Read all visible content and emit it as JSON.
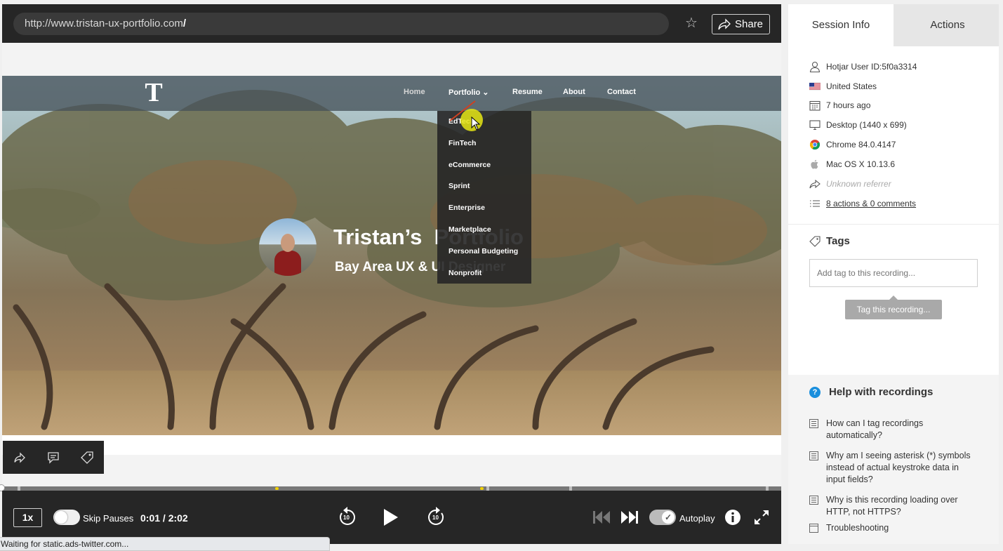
{
  "browser": {
    "url_base": "http://www.tristan-ux-portfolio.com",
    "url_suffix": "/",
    "share_label": "Share"
  },
  "site": {
    "logo": "T",
    "nav": [
      "Home",
      "Portfolio",
      "Resume",
      "About",
      "Contact"
    ],
    "dropdown": [
      "EdTech",
      "FinTech",
      "eCommerce",
      "Sprint",
      "Enterprise",
      "Marketplace",
      "Personal Budgeting",
      "Nonprofit"
    ],
    "hero_title": "Tristan’s  Portfolio",
    "hero_subtitle": "Bay Area UX & UI Designer"
  },
  "player": {
    "speed": "1x",
    "skip_pauses_label": "Skip Pauses",
    "time": "0:01 / 2:02",
    "rewind_label": "10",
    "forward_label": "10",
    "autoplay_label": "Autoplay",
    "skip_pauses_on": false,
    "autoplay_on": true
  },
  "status": "Waiting for static.ads-twitter.com...",
  "sidebar": {
    "tabs": [
      "Session Info",
      "Actions"
    ],
    "info": {
      "user_id": "Hotjar User ID:5f0a3314",
      "country": "United States",
      "time_ago": "7 hours ago",
      "device": "Desktop (1440 x 699)",
      "browser": "Chrome 84.0.4147",
      "os": "Mac OS X 10.13.6",
      "referrer": "Unknown referrer",
      "actions": "8 actions & 0 comments"
    },
    "tags": {
      "title": "Tags",
      "placeholder": "Add tag to this recording...",
      "tooltip": "Tag this recording..."
    },
    "help": {
      "title": "Help with recordings",
      "links": [
        "How can I tag recordings automatically?",
        "Why am I seeing asterisk (*) symbols instead of actual keystroke data in input fields?",
        "Why is this recording loading over HTTP, not HTTPS?",
        "Troubleshooting"
      ]
    }
  },
  "colors": {
    "player_dark": "#262626",
    "accent_blue": "#1a8fdd",
    "cursor_highlight": "#e6e614"
  }
}
